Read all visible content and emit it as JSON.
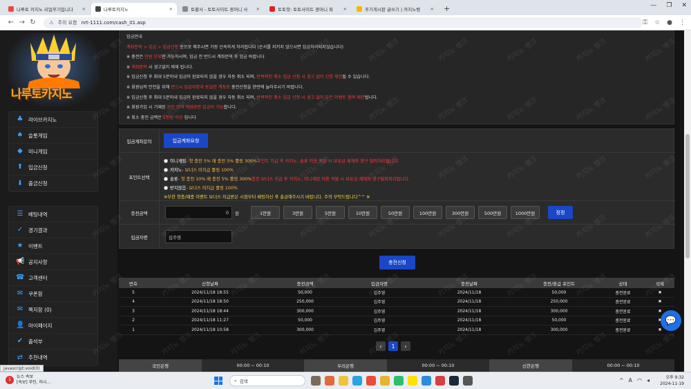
{
  "browser": {
    "tabs": [
      {
        "title": "나루토 카지노 리얼후기입니다",
        "favicon": "#e44",
        "active": false
      },
      {
        "title": "나루토카지노",
        "favicon": "#444",
        "active": true
      },
      {
        "title": "토황사 - 토토사이트 꽁머니 사",
        "favicon": "#888",
        "active": false
      },
      {
        "title": "토토핫: 토토사이트 꽁머니 파",
        "favicon": "#d22",
        "active": false
      },
      {
        "title": "후기게시판 글쓰기 | 카지노뱅",
        "favicon": "#f5b800",
        "active": false
      }
    ],
    "new_tab": "+",
    "security_label": "주의 요함",
    "url": "nrt-1111.com/cash_01.asp"
  },
  "sidebar": {
    "logo_text": "나루토카지노",
    "menu_group1": [
      {
        "label": "라이브카지노",
        "icon": "casino-icon"
      },
      {
        "label": "슬롯게임",
        "icon": "slot-icon"
      },
      {
        "label": "미니게임",
        "icon": "minigame-icon"
      },
      {
        "label": "입금신청",
        "icon": "deposit-icon"
      },
      {
        "label": "출금신청",
        "icon": "withdraw-icon"
      }
    ],
    "menu_group2": [
      {
        "label": "베팅내역",
        "icon": "list-icon"
      },
      {
        "label": "경기결과",
        "icon": "result-icon"
      },
      {
        "label": "이벤트",
        "icon": "event-icon"
      },
      {
        "label": "공지사항",
        "icon": "megaphone-icon"
      },
      {
        "label": "고객센터",
        "icon": "support-icon"
      },
      {
        "label": "쿠폰함",
        "icon": "coupon-icon"
      },
      {
        "label": "쪽지함 (0)",
        "icon": "message-icon"
      },
      {
        "label": "마이페이지",
        "icon": "user-icon"
      },
      {
        "label": "출석부",
        "icon": "checkin-icon"
      },
      {
        "label": "추천내역",
        "icon": "referral-icon"
      }
    ]
  },
  "notice": {
    "lines": [
      {
        "pre": "",
        "red": "",
        "post": "입금안내"
      },
      {
        "pre": "",
        "red": "계좌문의 > 입금 > 입금신청",
        "post": " 순으로 해주시면 가장 신속하게 처리됩니다 (순서를 지키지 않으시면 입금처리되지않습니다)"
      },
      {
        "pre": "※ 충전은 ",
        "red": "만원 단위",
        "post": "만 가능하시며, 입금 전 반드시 계좌문의 후 입금 바랍니다"
      },
      {
        "pre": "※ ",
        "red": "계좌문의",
        "post": " 시 경고없이 제재 됩니다."
      },
      {
        "pre": "※ 입금신청 후 최대 5분이내 입금이 완료되지 않을 경우 자동 취소 되며, ",
        "red": "반복적인 취소 입금 신청 시 경고 없이 신청 제한",
        "post": "될 수 있습니다."
      },
      {
        "pre": "※ 회원님의 안전을 위해 ",
        "red": "반드시 입금자명과 동일한 계좌로",
        "post": " 충전신청을 한번에 눌러주시기 바랍니다."
      },
      {
        "pre": "※ 입금신청 후 최대 5분이내 입금이 완료되지 않을 경우 자동 취소 되며, ",
        "red": "반복적인 취소 입금 신청 시 경고 없이 모든 이벤트 참여 제한",
        "post": "됩니다."
      },
      {
        "pre": "※ 회원가입 시 기재된 ",
        "red": "본인 명의 계좌로만 입금이 가능",
        "post": "합니다."
      },
      {
        "pre": "※ 최소 충전 금액은 ",
        "red": "1만원 이상",
        "post": " 입니다"
      }
    ]
  },
  "form": {
    "account_label": "입금계좌문의",
    "account_button": "입금계좌요청",
    "point_label": "포인트선택",
    "options": [
      {
        "name": "미니게임",
        "note": " - 첫 충전 5% 매 충전 5% 롤링 300% ",
        "red": "포인트 지급 후 카지노, 슬롯 이용 적발 시 보유금 제재와 영구 탈퇴처리됩니다."
      },
      {
        "name": "카지노",
        "note": " - 보너스 미지급 롤링 100%",
        "red": ""
      },
      {
        "name": "슬롯",
        "note": " - 첫 충전 10% 매 충전 5% 롤링 300% ",
        "red": "충전 보너스 지급 후 카지노, 미니게임 이용 적발 시 보유금 제재와 영구탈퇴처리됩니다."
      },
      {
        "name": "받지않음",
        "note": " - 보너스 미지급 롤링 100%",
        "red": ""
      }
    ],
    "promo": "※무한 첫충/매충 이벤트 보너스 지급받은 시점부터 베팅하신 후 출금해주시기 바랍니다. 주의 부탁드립니다^^ ※",
    "amount_label": "충전금액",
    "amount_value": "0",
    "amount_unit": "원",
    "amount_buttons": [
      "1만원",
      "3만원",
      "5만원",
      "10만원",
      "50만원",
      "100만원",
      "300만원",
      "500만원",
      "1000만원"
    ],
    "reset_button": "정정",
    "depositor_label": "입금자명",
    "depositor_value": "김주영",
    "submit": "충전신청"
  },
  "table": {
    "headers": [
      "번호",
      "신청날짜",
      "충전금액",
      "입금자명",
      "충전날짜",
      "충전/환급 포인트",
      "상태",
      "삭제"
    ],
    "rows": [
      [
        "5",
        "2024/11/18 18:55",
        "50,000",
        "김주영",
        "2024/11/18",
        "50,000",
        "충전완료",
        "✖"
      ],
      [
        "4",
        "2024/11/18 18:50",
        "250,000",
        "김주영",
        "2024/11/18",
        "250,000",
        "충전완료",
        "✖"
      ],
      [
        "3",
        "2024/11/18 18:44",
        "300,000",
        "김주영",
        "2024/11/18",
        "300,000",
        "충전완료",
        "✖"
      ],
      [
        "2",
        "2024/11/18 11:27",
        "50,000",
        "김주영",
        "2024/11/18",
        "50,000",
        "충전완료",
        "✖"
      ],
      [
        "1",
        "2024/11/18 10:58",
        "300,000",
        "김주영",
        "2024/11/18",
        "300,000",
        "충전완료",
        "✖"
      ]
    ]
  },
  "pagination": {
    "prev": "‹",
    "current": "1",
    "next": "›"
  },
  "banks": [
    {
      "name": "국민은행",
      "time": "00:00 ~ 00:10"
    },
    {
      "name": "우리은행",
      "time": "00:00 ~ 00:10"
    },
    {
      "name": "신한은행",
      "time": "00:00 ~ 00:10"
    }
  ],
  "status_url": "javascript:void(0)",
  "watermark": "카지노 뱅크",
  "taskbar": {
    "news_badge": "1",
    "news_title": "뉴스 속보",
    "news_sub": "[속보] 푸틴, 러시...",
    "search_placeholder": "검색",
    "time": "오후 9:32",
    "date": "2024-11-19"
  }
}
